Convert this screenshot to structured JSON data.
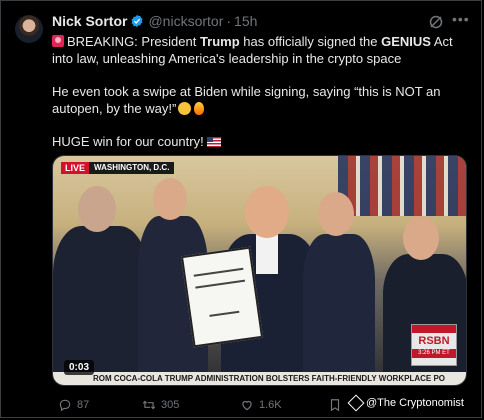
{
  "tweet": {
    "author_name": "Nick Sortor",
    "handle": "@nicksortor",
    "separator": "·",
    "time": "15h",
    "para1_prefix": "BREAKING: President ",
    "para1_bold1": "Trump",
    "para1_mid": " has officially signed the ",
    "para1_bold2": "GENIUS",
    "para1_suffix": " Act into law, unleashing America's leadership in the crypto space",
    "para2": "He even took a swipe at Biden while signing, saying “this is NOT an autopen, by the way!”",
    "para3": "HUGE win for our country!"
  },
  "video": {
    "live_label": "LIVE",
    "location": "WASHINGTON, D.C.",
    "rsbn_label": "RSBN",
    "rsbn_time": "3:26 PM ET",
    "ticker": "ROM COCA-COLA   TRUMP ADMINISTRATION BOLSTERS FAITH-FRIENDLY WORKPLACE PO",
    "timestamp": "0:03"
  },
  "actions": {
    "replies": "87",
    "reposts": "305",
    "likes": "1.6K"
  },
  "watermark": "@The Cryptonomist",
  "colors": {
    "accent": "#1d9bf0",
    "muted": "#71767b",
    "text": "#e7e9ea"
  }
}
